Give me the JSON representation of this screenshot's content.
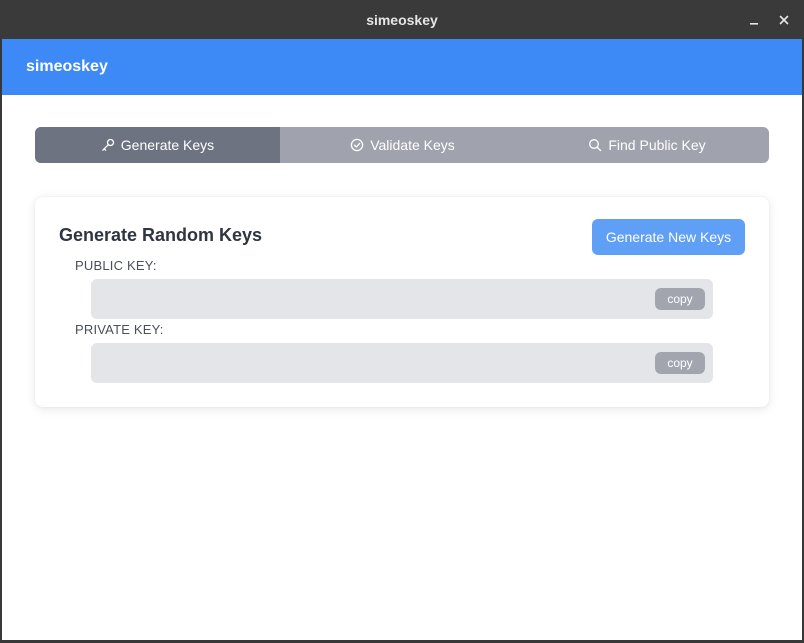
{
  "window": {
    "title": "simeoskey",
    "controls": {
      "minimize": "minimize-icon",
      "close": "close-icon"
    }
  },
  "appbar": {
    "brand": "simeoskey",
    "color": "#3d8af7"
  },
  "tabs": [
    {
      "label": "Generate Keys",
      "icon": "key-icon",
      "active": true
    },
    {
      "label": "Validate Keys",
      "icon": "check-circle-icon",
      "active": false
    },
    {
      "label": "Find Public Key",
      "icon": "search-icon",
      "active": false
    }
  ],
  "generate": {
    "title": "Generate Random Keys",
    "button_label": "Generate New Keys",
    "public_key": {
      "label": "PUBLIC KEY:",
      "value": "",
      "copy_label": "copy"
    },
    "private_key": {
      "label": "PRIVATE KEY:",
      "value": "",
      "copy_label": "copy"
    }
  }
}
